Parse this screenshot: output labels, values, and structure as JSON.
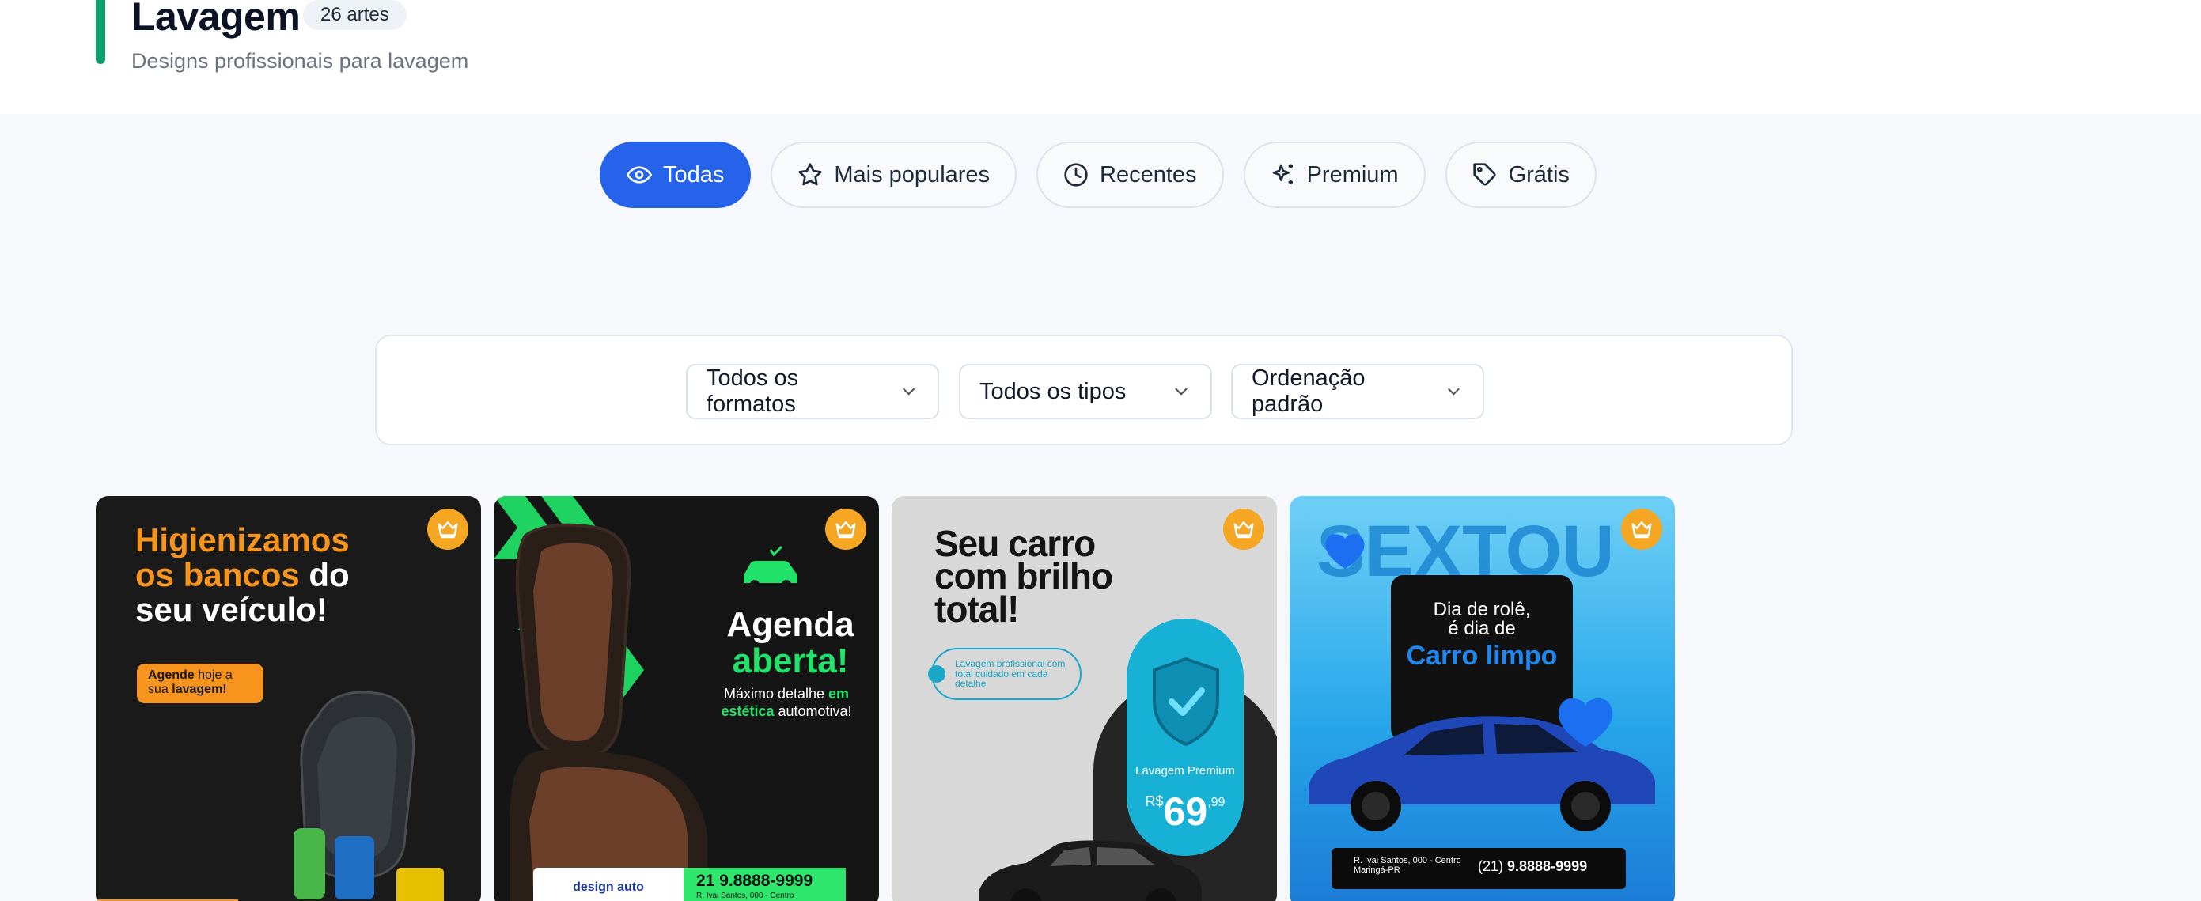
{
  "header": {
    "title": "Lavagem",
    "count_badge": "26 artes",
    "subtitle": "Designs profissionais para lavagem",
    "accent_color": "#0e9f6e"
  },
  "tabs": [
    {
      "label": "Todas",
      "icon": "eye-icon",
      "active": true
    },
    {
      "label": "Mais populares",
      "icon": "star-icon",
      "active": false
    },
    {
      "label": "Recentes",
      "icon": "clock-icon",
      "active": false
    },
    {
      "label": "Premium",
      "icon": "sparkles-icon",
      "active": false
    },
    {
      "label": "Grátis",
      "icon": "tag-icon",
      "active": false
    }
  ],
  "filters": {
    "format": "Todos os formatos",
    "type": "Todos os tipos",
    "sort": "Ordenação padrão"
  },
  "cards": [
    {
      "premium": true,
      "headline_1": "Higienizamos",
      "headline_2": "os bancos",
      "headline_3": " do",
      "headline_4": "seu veículo!",
      "pill_bold": "Agende",
      "pill_rest": " hoje a sua ",
      "pill_bold_2": "lavagem!"
    },
    {
      "premium": true,
      "headline_1": "Agenda",
      "headline_2": "aberta!",
      "sub_1": "Máximo detalhe ",
      "sub_2": "em estética",
      "sub_3": " automotiva!",
      "brand": "design auto",
      "phone": "21 9.8888-9999",
      "address": "R. Ivai Santos, 000 - Centro"
    },
    {
      "premium": true,
      "headline_1": "Seu carro",
      "headline_2": "com brilho",
      "headline_3": "total!",
      "tag_text": "Lavagem profissional com total cuidado em cada detalhe",
      "plan_label": "Lavagem Premium",
      "currency": "R$",
      "price": "69",
      "cents": ",99"
    },
    {
      "premium": true,
      "background_word": "SEXTOU",
      "line_1": "Dia de rolê,",
      "line_2": "é dia de",
      "line_3": "Carro limpo",
      "address_1": "R. Ivai Santos, 000 - Centro",
      "address_2": "Maringá-PR",
      "phone_prefix": "(21) ",
      "phone": "9.8888-9999"
    }
  ],
  "colors": {
    "primary": "#2563eb",
    "premium_crown": "#f5a623",
    "card1_orange": "#f7941d",
    "card2_green": "#22e36a",
    "card3_cyan": "#18b1d6"
  }
}
